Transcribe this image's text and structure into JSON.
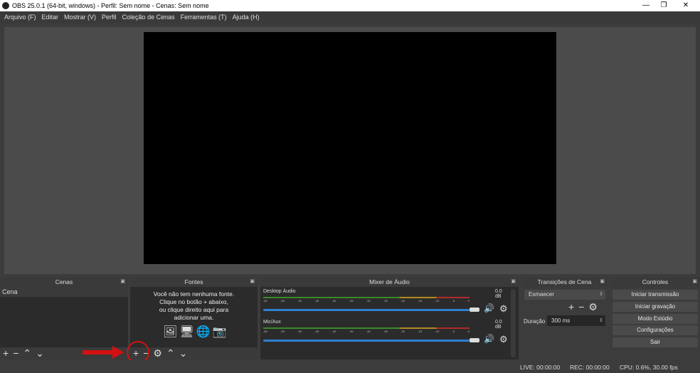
{
  "window": {
    "title": "OBS 25.0.1 (64-bit, windows) - Perfil: Sem nome - Cenas: Sem nome",
    "minimize": "—",
    "maximize": "❐",
    "close": "✕"
  },
  "menu": [
    "Arquivo (F)",
    "Editar",
    "Mostrar (V)",
    "Perfil",
    "Coleção de Cenas",
    "Ferramentas (T)",
    "Ajuda (H)"
  ],
  "scenes": {
    "title": "Cenas",
    "items": [
      "Cena"
    ]
  },
  "sources": {
    "title": "Fontes",
    "empty_lines": [
      "Você não tem nenhuma fonte.",
      "Clique no botão + abaixo,",
      "ou clique direito aqui para",
      "adicionar uma."
    ]
  },
  "mixer": {
    "title": "Mixer de Áudio",
    "ticks": [
      "-60",
      "-55",
      "-50",
      "-45",
      "-40",
      "-35",
      "-30",
      "-25",
      "-20",
      "-15",
      "-10",
      "-5",
      "0"
    ],
    "channels": [
      {
        "name": "Desktop Áudio",
        "level": "0.0 dB",
        "volume": 1.0
      },
      {
        "name": "Mic/Aux",
        "level": "0.0 dB",
        "volume": 1.0
      }
    ]
  },
  "transitions": {
    "title": "Transições de Cena",
    "selected": "Esmaecer",
    "duration_label": "Duração",
    "duration": "300 ms"
  },
  "controls": {
    "title": "Controles",
    "buttons": [
      "Iniciar transmissão",
      "Iniciar gravação",
      "Modo Estúdio",
      "Configurações",
      "Sair"
    ]
  },
  "status": {
    "live": "LIVE: 00:00:00",
    "rec": "REC: 00:00:00",
    "cpu": "CPU: 0.6%, 30.00 fps"
  },
  "colors": {
    "annotation": "#d41010",
    "slider": "#2e7fd0"
  }
}
